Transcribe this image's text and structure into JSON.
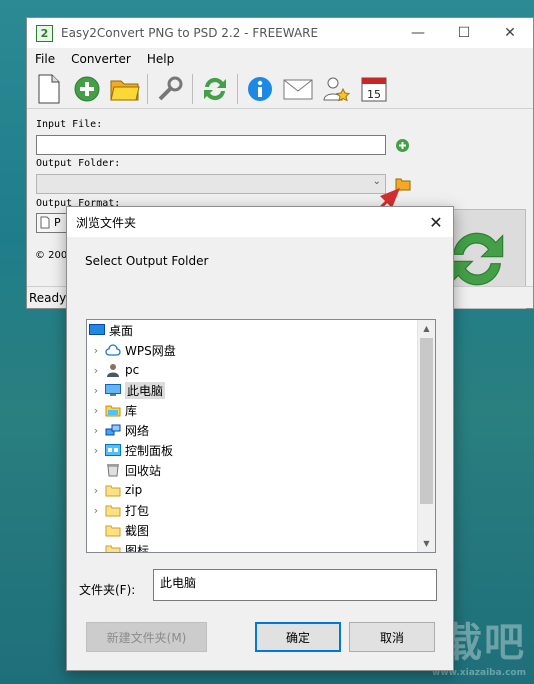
{
  "app": {
    "title": "Easy2Convert PNG to PSD 2.2 - FREEWARE",
    "icon_text": "2",
    "menu": [
      "File",
      "Converter",
      "Help"
    ],
    "toolbar_icons": [
      "new-file-icon",
      "add-icon",
      "open-folder-icon",
      "wrench-icon",
      "refresh-icon",
      "info-icon",
      "mail-icon",
      "user-star-icon",
      "calendar-icon"
    ],
    "calendar_day": "15",
    "input_file_label": "Input File:",
    "output_folder_label": "Output Folder:",
    "output_format_label": "Output Format:",
    "format_value_partial": "P",
    "copyright_partial": "© 200",
    "status": "Ready"
  },
  "dialog": {
    "title": "浏览文件夹",
    "description": "Select Output Folder",
    "tree": [
      {
        "label": "桌面",
        "icon": "desktop-icon",
        "expandable": false,
        "indent": 0,
        "selected": false
      },
      {
        "label": "WPS网盘",
        "icon": "cloud-icon",
        "expandable": true,
        "indent": 1,
        "selected": false
      },
      {
        "label": "pc",
        "icon": "user-icon",
        "expandable": true,
        "indent": 1,
        "selected": false
      },
      {
        "label": "此电脑",
        "icon": "computer-icon",
        "expandable": true,
        "indent": 1,
        "selected": true
      },
      {
        "label": "库",
        "icon": "library-icon",
        "expandable": true,
        "indent": 1,
        "selected": false
      },
      {
        "label": "网络",
        "icon": "network-icon",
        "expandable": true,
        "indent": 1,
        "selected": false
      },
      {
        "label": "控制面板",
        "icon": "control-panel-icon",
        "expandable": true,
        "indent": 1,
        "selected": false
      },
      {
        "label": "回收站",
        "icon": "recycle-bin-icon",
        "expandable": false,
        "indent": 1,
        "selected": false
      },
      {
        "label": "zip",
        "icon": "folder-icon",
        "expandable": true,
        "indent": 1,
        "selected": false
      },
      {
        "label": "打包",
        "icon": "folder-icon",
        "expandable": true,
        "indent": 1,
        "selected": false
      },
      {
        "label": "截图",
        "icon": "folder-icon",
        "expandable": false,
        "indent": 1,
        "selected": false
      },
      {
        "label": "图标",
        "icon": "folder-icon",
        "expandable": false,
        "indent": 1,
        "selected": false
      }
    ],
    "folder_label": "文件夹(F):",
    "folder_value": "此电脑",
    "new_folder_button": "新建文件夹(M)",
    "ok_button": "确定",
    "cancel_button": "取消"
  },
  "watermark": {
    "text": "下载吧",
    "sub": "www.xiazaiba.com"
  },
  "colors": {
    "accent": "#0078d7",
    "arrow": "#d32f2f",
    "green": "#43a047"
  }
}
